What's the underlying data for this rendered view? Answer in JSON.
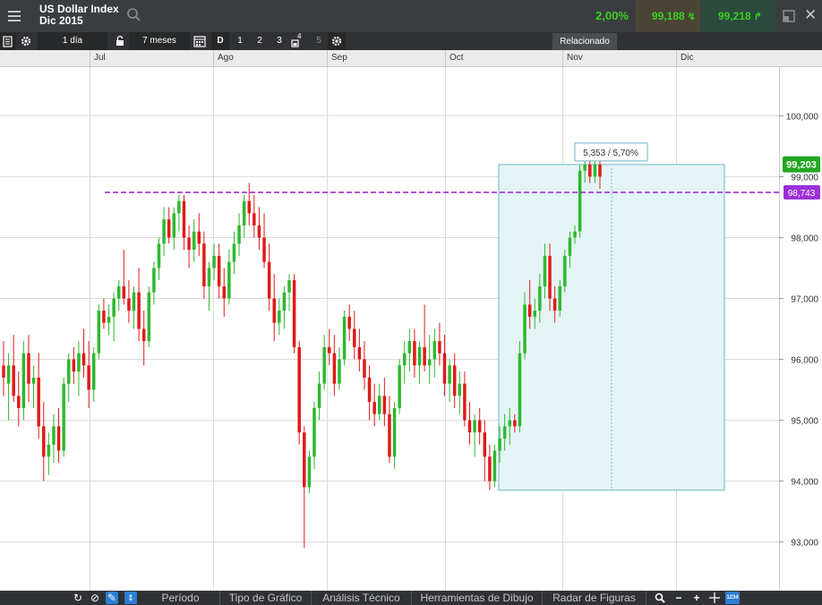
{
  "header": {
    "instrument_name": "US Dollar Index",
    "contract": "Dic 2015",
    "change_pct": "2,00%",
    "sell_price": "99,188",
    "buy_price": "99,218"
  },
  "toolbar": {
    "interval": "1 día",
    "range": "7 meses",
    "view_d": "D",
    "view_1": "1",
    "view_2": "2",
    "view_3": "3",
    "view_4": "4",
    "view_5": "5",
    "related": "Relacionado"
  },
  "date_axis": {
    "months": [
      "Jul",
      "Ago",
      "Sep",
      "Oct",
      "Nov",
      "Dic"
    ]
  },
  "price_axis": {
    "labels": [
      "100,000",
      "99,000",
      "98,000",
      "97,000",
      "96,000",
      "95,000",
      "94,000",
      "93,000"
    ],
    "current_price": "99,203",
    "line_level": "98,743"
  },
  "measure_tool": {
    "label": "5,353 / 5,70%"
  },
  "bottom_bar": {
    "tabs": [
      "Período",
      "Tipo de Gráfico",
      "Análisis Técnico",
      "Herramientas de Dibujo",
      "Radar de Figuras"
    ],
    "counter": "1234"
  },
  "colors": {
    "up": "#2eb82e",
    "down": "#e01a1a",
    "level_line": "#9b30d9",
    "current_badge": "#22a722",
    "measure_fill": "#e5f5f7",
    "measure_stroke": "#6bb7c8"
  },
  "chart_data": {
    "type": "candlestick",
    "y_axis": {
      "min": 92.2,
      "max": 100.8,
      "ticks": [
        100,
        99,
        98,
        97,
        96,
        95,
        94,
        93
      ]
    },
    "horizontal_level": 98.743,
    "current_price": 99.203,
    "measure": {
      "low": 93.85,
      "high": 99.2
    },
    "candles": [
      {
        "o": 95.9,
        "h": 96.3,
        "l": 95.4,
        "c": 95.7
      },
      {
        "o": 95.6,
        "h": 96.1,
        "l": 95.0,
        "c": 95.9
      },
      {
        "o": 95.9,
        "h": 96.4,
        "l": 95.3,
        "c": 95.4
      },
      {
        "o": 95.4,
        "h": 95.8,
        "l": 94.9,
        "c": 95.2
      },
      {
        "o": 95.2,
        "h": 96.3,
        "l": 95.0,
        "c": 96.1
      },
      {
        "o": 96.1,
        "h": 96.4,
        "l": 95.3,
        "c": 95.6
      },
      {
        "o": 95.6,
        "h": 95.9,
        "l": 95.2,
        "c": 95.7
      },
      {
        "o": 95.7,
        "h": 96.1,
        "l": 94.7,
        "c": 94.9
      },
      {
        "o": 94.9,
        "h": 95.3,
        "l": 94.0,
        "c": 94.4
      },
      {
        "o": 94.4,
        "h": 94.8,
        "l": 94.1,
        "c": 94.6
      },
      {
        "o": 94.6,
        "h": 95.1,
        "l": 94.3,
        "c": 94.9
      },
      {
        "o": 94.9,
        "h": 95.2,
        "l": 94.3,
        "c": 94.5
      },
      {
        "o": 94.5,
        "h": 95.7,
        "l": 94.4,
        "c": 95.6
      },
      {
        "o": 95.6,
        "h": 96.1,
        "l": 95.3,
        "c": 96.0
      },
      {
        "o": 96.0,
        "h": 96.2,
        "l": 95.6,
        "c": 95.8
      },
      {
        "o": 95.8,
        "h": 96.3,
        "l": 95.4,
        "c": 96.1
      },
      {
        "o": 96.1,
        "h": 96.5,
        "l": 95.7,
        "c": 95.9
      },
      {
        "o": 95.9,
        "h": 96.3,
        "l": 95.2,
        "c": 95.5
      },
      {
        "o": 95.5,
        "h": 96.2,
        "l": 95.3,
        "c": 96.1
      },
      {
        "o": 96.1,
        "h": 96.9,
        "l": 96.0,
        "c": 96.8
      },
      {
        "o": 96.8,
        "h": 97.0,
        "l": 96.5,
        "c": 96.6
      },
      {
        "o": 96.6,
        "h": 96.9,
        "l": 96.4,
        "c": 96.7
      },
      {
        "o": 96.7,
        "h": 97.1,
        "l": 96.3,
        "c": 97.0
      },
      {
        "o": 97.0,
        "h": 97.3,
        "l": 96.8,
        "c": 97.2
      },
      {
        "o": 97.2,
        "h": 97.8,
        "l": 96.9,
        "c": 97.0
      },
      {
        "o": 97.0,
        "h": 97.3,
        "l": 96.6,
        "c": 96.8
      },
      {
        "o": 96.8,
        "h": 97.2,
        "l": 96.5,
        "c": 97.1
      },
      {
        "o": 97.1,
        "h": 97.5,
        "l": 96.3,
        "c": 96.5
      },
      {
        "o": 96.5,
        "h": 96.8,
        "l": 95.9,
        "c": 96.3
      },
      {
        "o": 96.3,
        "h": 97.2,
        "l": 96.2,
        "c": 97.1
      },
      {
        "o": 97.1,
        "h": 97.6,
        "l": 96.9,
        "c": 97.5
      },
      {
        "o": 97.5,
        "h": 98.0,
        "l": 97.3,
        "c": 97.9
      },
      {
        "o": 97.9,
        "h": 98.5,
        "l": 97.7,
        "c": 98.3
      },
      {
        "o": 98.3,
        "h": 98.5,
        "l": 97.9,
        "c": 98.0
      },
      {
        "o": 98.0,
        "h": 98.5,
        "l": 97.8,
        "c": 98.4
      },
      {
        "o": 98.4,
        "h": 98.7,
        "l": 98.1,
        "c": 98.6
      },
      {
        "o": 98.6,
        "h": 98.7,
        "l": 97.8,
        "c": 98.0
      },
      {
        "o": 98.0,
        "h": 98.2,
        "l": 97.5,
        "c": 97.8
      },
      {
        "o": 97.8,
        "h": 98.3,
        "l": 97.6,
        "c": 98.1
      },
      {
        "o": 98.1,
        "h": 98.4,
        "l": 97.7,
        "c": 97.9
      },
      {
        "o": 97.9,
        "h": 98.1,
        "l": 97.0,
        "c": 97.2
      },
      {
        "o": 97.2,
        "h": 97.6,
        "l": 96.8,
        "c": 97.5
      },
      {
        "o": 97.5,
        "h": 97.9,
        "l": 97.3,
        "c": 97.7
      },
      {
        "o": 97.7,
        "h": 97.9,
        "l": 97.0,
        "c": 97.2
      },
      {
        "o": 97.2,
        "h": 97.5,
        "l": 96.7,
        "c": 97.0
      },
      {
        "o": 97.0,
        "h": 97.8,
        "l": 96.9,
        "c": 97.6
      },
      {
        "o": 97.6,
        "h": 98.1,
        "l": 97.4,
        "c": 97.9
      },
      {
        "o": 97.9,
        "h": 98.4,
        "l": 97.7,
        "c": 98.2
      },
      {
        "o": 98.2,
        "h": 98.7,
        "l": 98.0,
        "c": 98.6
      },
      {
        "o": 98.6,
        "h": 98.9,
        "l": 98.2,
        "c": 98.4
      },
      {
        "o": 98.4,
        "h": 98.7,
        "l": 98.0,
        "c": 98.2
      },
      {
        "o": 98.2,
        "h": 98.5,
        "l": 97.8,
        "c": 98.0
      },
      {
        "o": 98.0,
        "h": 98.4,
        "l": 97.5,
        "c": 97.6
      },
      {
        "o": 97.6,
        "h": 97.9,
        "l": 96.8,
        "c": 97.0
      },
      {
        "o": 97.0,
        "h": 97.4,
        "l": 96.3,
        "c": 96.6
      },
      {
        "o": 96.6,
        "h": 97.0,
        "l": 96.4,
        "c": 96.8
      },
      {
        "o": 96.8,
        "h": 97.2,
        "l": 96.5,
        "c": 97.1
      },
      {
        "o": 97.1,
        "h": 97.4,
        "l": 96.8,
        "c": 97.3
      },
      {
        "o": 97.3,
        "h": 97.4,
        "l": 96.1,
        "c": 96.2
      },
      {
        "o": 96.2,
        "h": 96.3,
        "l": 94.6,
        "c": 94.8
      },
      {
        "o": 94.8,
        "h": 94.9,
        "l": 92.9,
        "c": 93.9
      },
      {
        "o": 93.9,
        "h": 94.5,
        "l": 93.8,
        "c": 94.4
      },
      {
        "o": 94.4,
        "h": 95.3,
        "l": 94.2,
        "c": 95.2
      },
      {
        "o": 95.2,
        "h": 95.8,
        "l": 95.0,
        "c": 95.6
      },
      {
        "o": 95.6,
        "h": 96.4,
        "l": 95.5,
        "c": 96.2
      },
      {
        "o": 96.2,
        "h": 96.5,
        "l": 95.9,
        "c": 96.1
      },
      {
        "o": 96.1,
        "h": 96.4,
        "l": 95.4,
        "c": 95.6
      },
      {
        "o": 95.6,
        "h": 96.2,
        "l": 95.5,
        "c": 96.0
      },
      {
        "o": 96.0,
        "h": 96.8,
        "l": 95.9,
        "c": 96.7
      },
      {
        "o": 96.7,
        "h": 96.9,
        "l": 96.3,
        "c": 96.5
      },
      {
        "o": 96.5,
        "h": 96.8,
        "l": 96.0,
        "c": 96.2
      },
      {
        "o": 96.2,
        "h": 96.5,
        "l": 95.8,
        "c": 96.0
      },
      {
        "o": 96.0,
        "h": 96.3,
        "l": 95.5,
        "c": 95.7
      },
      {
        "o": 95.7,
        "h": 95.9,
        "l": 95.0,
        "c": 95.3
      },
      {
        "o": 95.3,
        "h": 95.6,
        "l": 94.9,
        "c": 95.1
      },
      {
        "o": 95.1,
        "h": 95.6,
        "l": 95.0,
        "c": 95.4
      },
      {
        "o": 95.4,
        "h": 95.7,
        "l": 94.9,
        "c": 95.1
      },
      {
        "o": 95.1,
        "h": 95.4,
        "l": 94.3,
        "c": 94.4
      },
      {
        "o": 94.4,
        "h": 95.3,
        "l": 94.2,
        "c": 95.2
      },
      {
        "o": 95.2,
        "h": 96.0,
        "l": 95.1,
        "c": 95.9
      },
      {
        "o": 95.9,
        "h": 96.3,
        "l": 95.6,
        "c": 96.1
      },
      {
        "o": 96.1,
        "h": 96.5,
        "l": 95.8,
        "c": 96.3
      },
      {
        "o": 96.3,
        "h": 96.5,
        "l": 95.7,
        "c": 95.9
      },
      {
        "o": 95.9,
        "h": 96.3,
        "l": 95.6,
        "c": 96.2
      },
      {
        "o": 96.2,
        "h": 96.9,
        "l": 95.8,
        "c": 95.9
      },
      {
        "o": 95.9,
        "h": 96.4,
        "l": 95.6,
        "c": 96.0
      },
      {
        "o": 96.0,
        "h": 96.5,
        "l": 95.7,
        "c": 96.3
      },
      {
        "o": 96.3,
        "h": 96.6,
        "l": 95.9,
        "c": 96.1
      },
      {
        "o": 96.1,
        "h": 96.4,
        "l": 95.4,
        "c": 95.6
      },
      {
        "o": 95.6,
        "h": 96.0,
        "l": 95.3,
        "c": 95.9
      },
      {
        "o": 95.9,
        "h": 96.1,
        "l": 95.2,
        "c": 95.4
      },
      {
        "o": 95.4,
        "h": 95.8,
        "l": 95.1,
        "c": 95.6
      },
      {
        "o": 95.6,
        "h": 95.8,
        "l": 94.9,
        "c": 95.0
      },
      {
        "o": 95.0,
        "h": 95.3,
        "l": 94.6,
        "c": 94.8
      },
      {
        "o": 94.8,
        "h": 95.1,
        "l": 94.4,
        "c": 95.0
      },
      {
        "o": 95.0,
        "h": 95.2,
        "l": 94.6,
        "c": 94.8
      },
      {
        "o": 94.8,
        "h": 95.0,
        "l": 94.0,
        "c": 94.4
      },
      {
        "o": 94.4,
        "h": 94.6,
        "l": 93.85,
        "c": 94.0
      },
      {
        "o": 94.0,
        "h": 94.6,
        "l": 93.9,
        "c": 94.5
      },
      {
        "o": 94.5,
        "h": 94.9,
        "l": 94.3,
        "c": 94.7
      },
      {
        "o": 94.7,
        "h": 95.1,
        "l": 94.5,
        "c": 94.9
      },
      {
        "o": 94.9,
        "h": 95.2,
        "l": 94.6,
        "c": 95.0
      },
      {
        "o": 95.0,
        "h": 95.1,
        "l": 94.8,
        "c": 94.9
      },
      {
        "o": 94.9,
        "h": 96.3,
        "l": 94.8,
        "c": 96.1
      },
      {
        "o": 96.1,
        "h": 97.1,
        "l": 96.0,
        "c": 96.9
      },
      {
        "o": 96.9,
        "h": 97.3,
        "l": 96.5,
        "c": 96.7
      },
      {
        "o": 96.7,
        "h": 97.0,
        "l": 96.5,
        "c": 96.8
      },
      {
        "o": 96.8,
        "h": 97.4,
        "l": 96.6,
        "c": 97.2
      },
      {
        "o": 97.2,
        "h": 97.9,
        "l": 97.0,
        "c": 97.7
      },
      {
        "o": 97.7,
        "h": 97.9,
        "l": 96.8,
        "c": 97.0
      },
      {
        "o": 97.0,
        "h": 97.2,
        "l": 96.6,
        "c": 96.8
      },
      {
        "o": 96.8,
        "h": 97.3,
        "l": 96.7,
        "c": 97.2
      },
      {
        "o": 97.2,
        "h": 97.8,
        "l": 97.1,
        "c": 97.7
      },
      {
        "o": 97.7,
        "h": 98.1,
        "l": 97.5,
        "c": 98.0
      },
      {
        "o": 98.0,
        "h": 98.2,
        "l": 97.9,
        "c": 98.1
      },
      {
        "o": 98.1,
        "h": 99.2,
        "l": 98.0,
        "c": 99.1
      },
      {
        "o": 99.1,
        "h": 99.5,
        "l": 98.9,
        "c": 99.2
      },
      {
        "o": 99.2,
        "h": 99.4,
        "l": 98.9,
        "c": 99.0
      },
      {
        "o": 99.0,
        "h": 99.3,
        "l": 98.9,
        "c": 99.2
      },
      {
        "o": 99.2,
        "h": 99.3,
        "l": 98.8,
        "c": 99.0
      }
    ]
  }
}
